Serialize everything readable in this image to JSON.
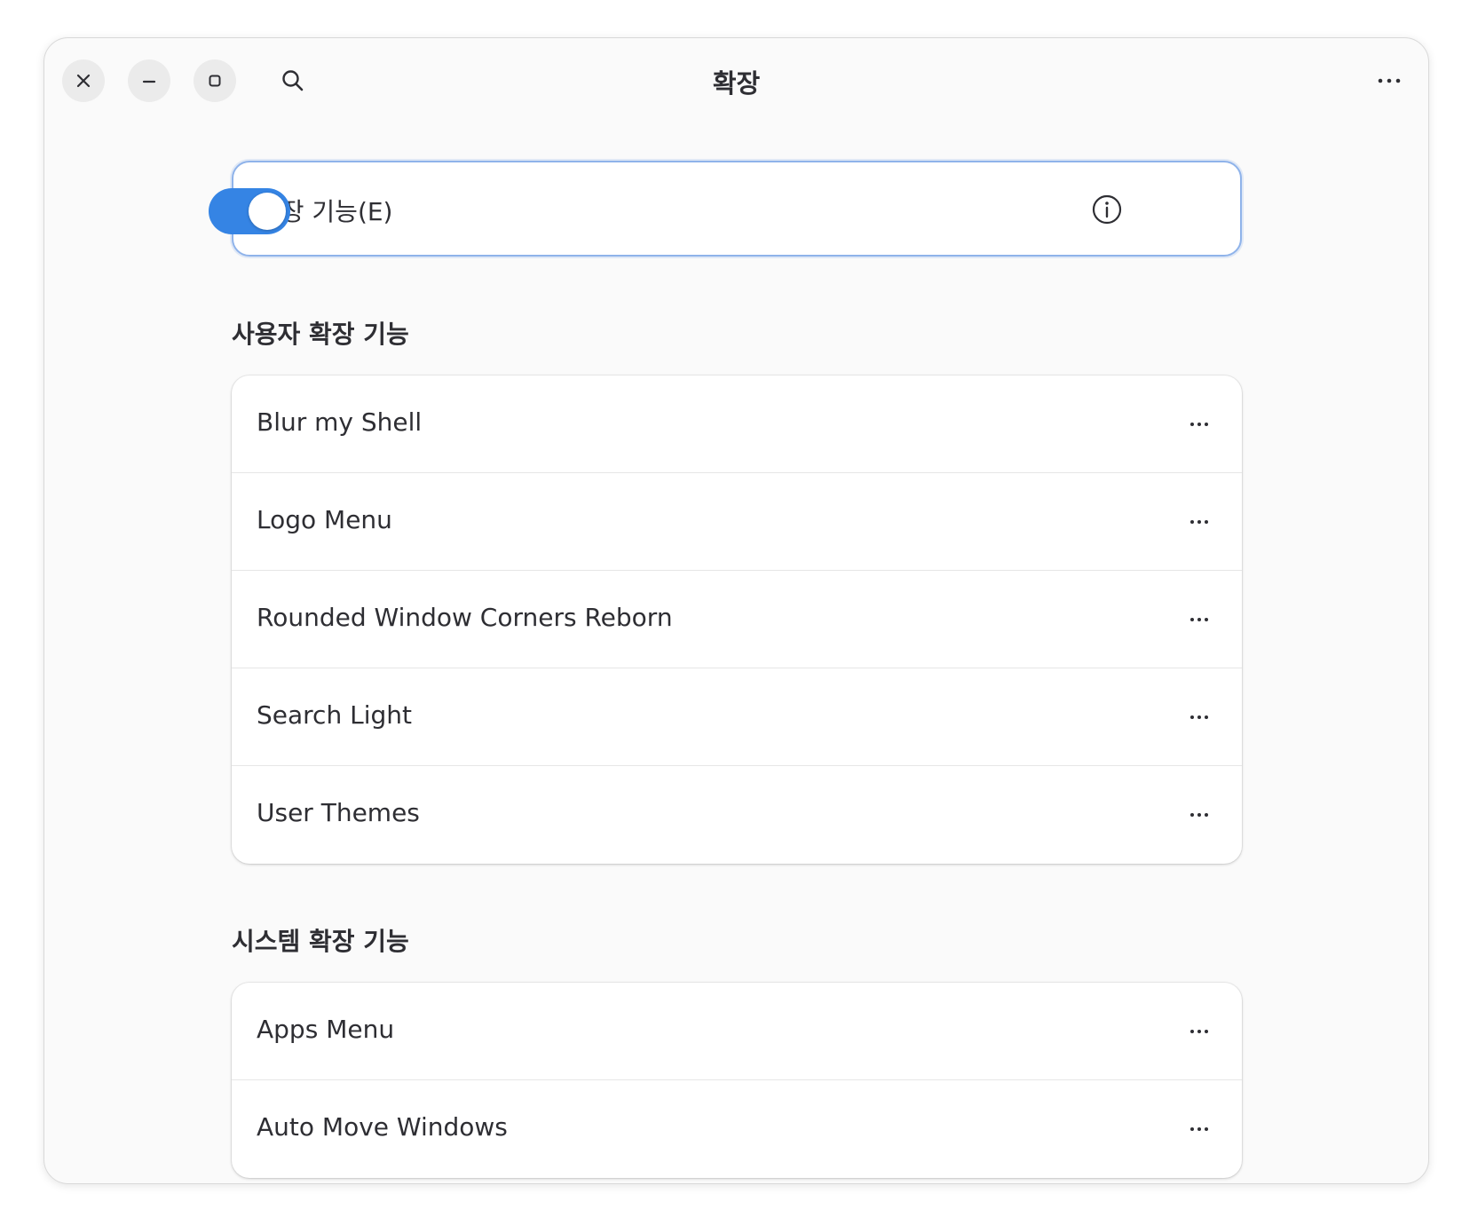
{
  "window": {
    "title": "확장"
  },
  "master": {
    "label": "확장 기능(E)",
    "enabled": true
  },
  "user_section": {
    "title": "사용자 확장 기능",
    "items": [
      {
        "name": "Blur my Shell",
        "enabled": true
      },
      {
        "name": "Logo Menu",
        "enabled": true
      },
      {
        "name": "Rounded Window Corners Reborn",
        "enabled": true
      },
      {
        "name": "Search Light",
        "enabled": true
      },
      {
        "name": "User Themes",
        "enabled": true
      }
    ]
  },
  "system_section": {
    "title": "시스템 확장 기능",
    "items": [
      {
        "name": "Apps Menu",
        "enabled": false
      },
      {
        "name": "Auto Move Windows",
        "enabled": false
      }
    ]
  },
  "colors": {
    "accent": "#3584e4",
    "switch_off": "#dcdcdc",
    "focus_ring": "#8fb3ea"
  }
}
